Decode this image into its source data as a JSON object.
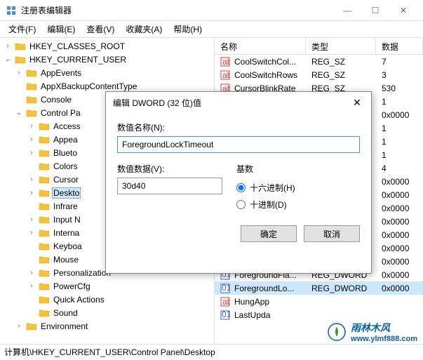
{
  "window": {
    "title": "注册表编辑器",
    "minimize": "—",
    "maximize": "☐",
    "close": "✕"
  },
  "menu": {
    "file": "文件(F)",
    "edit": "编辑(E)",
    "view": "查看(V)",
    "favorites": "收藏夹(A)",
    "help": "帮助(H)"
  },
  "tree": {
    "items": [
      {
        "level": 0,
        "toggle": "›",
        "label": "HKEY_CLASSES_ROOT"
      },
      {
        "level": 0,
        "toggle": "⌄",
        "label": "HKEY_CURRENT_USER"
      },
      {
        "level": 1,
        "toggle": "›",
        "label": "AppEvents"
      },
      {
        "level": 1,
        "toggle": "",
        "label": "AppXBackupContentType"
      },
      {
        "level": 1,
        "toggle": "",
        "label": "Console"
      },
      {
        "level": 1,
        "toggle": "⌄",
        "label": "Control Pa"
      },
      {
        "level": 2,
        "toggle": "›",
        "label": "Access"
      },
      {
        "level": 2,
        "toggle": "›",
        "label": "Appea"
      },
      {
        "level": 2,
        "toggle": "›",
        "label": "Blueto"
      },
      {
        "level": 2,
        "toggle": "",
        "label": "Colors"
      },
      {
        "level": 2,
        "toggle": "›",
        "label": "Cursor"
      },
      {
        "level": 2,
        "toggle": "›",
        "label": "Deskto",
        "selected": true
      },
      {
        "level": 2,
        "toggle": "",
        "label": "Infrare"
      },
      {
        "level": 2,
        "toggle": "›",
        "label": "Input N"
      },
      {
        "level": 2,
        "toggle": "›",
        "label": "Interna"
      },
      {
        "level": 2,
        "toggle": "",
        "label": "Keyboa"
      },
      {
        "level": 2,
        "toggle": "",
        "label": "Mouse"
      },
      {
        "level": 2,
        "toggle": "›",
        "label": "Personalization"
      },
      {
        "level": 2,
        "toggle": "›",
        "label": "PowerCfg"
      },
      {
        "level": 2,
        "toggle": "",
        "label": "Quick Actions"
      },
      {
        "level": 2,
        "toggle": "",
        "label": "Sound"
      },
      {
        "level": 1,
        "toggle": "›",
        "label": "Environment"
      }
    ]
  },
  "list": {
    "headers": {
      "name": "名称",
      "type": "类型",
      "data": "数据"
    },
    "rows": [
      {
        "icon": "string",
        "name": "CoolSwitchCol...",
        "type": "REG_SZ",
        "data": "7"
      },
      {
        "icon": "string",
        "name": "CoolSwitchRows",
        "type": "REG_SZ",
        "data": "3"
      },
      {
        "icon": "string",
        "name": "CursorBlinkRate",
        "type": "REG_SZ",
        "data": "530"
      },
      {
        "icon": "",
        "name": "",
        "type": "",
        "data": "1"
      },
      {
        "icon": "",
        "name": "",
        "type": "",
        "data": "0x0000"
      },
      {
        "icon": "",
        "name": "",
        "type": "",
        "data": "1"
      },
      {
        "icon": "",
        "name": "",
        "type": "",
        "data": "1"
      },
      {
        "icon": "",
        "name": "",
        "type": "",
        "data": "1"
      },
      {
        "icon": "",
        "name": "",
        "type": "",
        "data": "4"
      },
      {
        "icon": "",
        "name": "",
        "type": "",
        "data": "0x0000"
      },
      {
        "icon": "",
        "name": "",
        "type": "",
        "data": "0x0000"
      },
      {
        "icon": "",
        "name": "",
        "type": "",
        "data": "0x0000"
      },
      {
        "icon": "",
        "name": "",
        "type": "",
        "data": "0x0000"
      },
      {
        "icon": "",
        "name": "",
        "type": "",
        "data": "0x0000"
      },
      {
        "icon": "",
        "name": "",
        "type": "",
        "data": "0x0000"
      },
      {
        "icon": "",
        "name": "",
        "type": "",
        "data": "0x0000"
      },
      {
        "icon": "dword",
        "name": "ForegroundFla...",
        "type": "REG_DWORD",
        "data": "0x0000"
      },
      {
        "icon": "dword",
        "name": "ForegroundLo...",
        "type": "REG_DWORD",
        "data": "0x0000",
        "selected": true
      },
      {
        "icon": "string",
        "name": "HungApp",
        "type": "",
        "data": ""
      },
      {
        "icon": "dword",
        "name": "LastUpda",
        "type": "",
        "data": ""
      }
    ]
  },
  "dialog": {
    "title": "编辑 DWORD (32 位)值",
    "name_label": "数值名称(N):",
    "name_value": "ForegroundLockTimeout",
    "data_label": "数值数据(V):",
    "data_value": "30d40",
    "base_label": "基数",
    "hex_label": "十六进制(H)",
    "dec_label": "十进制(D)",
    "ok": "确定",
    "cancel": "取消"
  },
  "statusbar": {
    "path": "计算机\\HKEY_CURRENT_USER\\Control Panel\\Desktop"
  },
  "watermark": {
    "brand": "雨林木风",
    "url": "www.ylmf888.com"
  }
}
